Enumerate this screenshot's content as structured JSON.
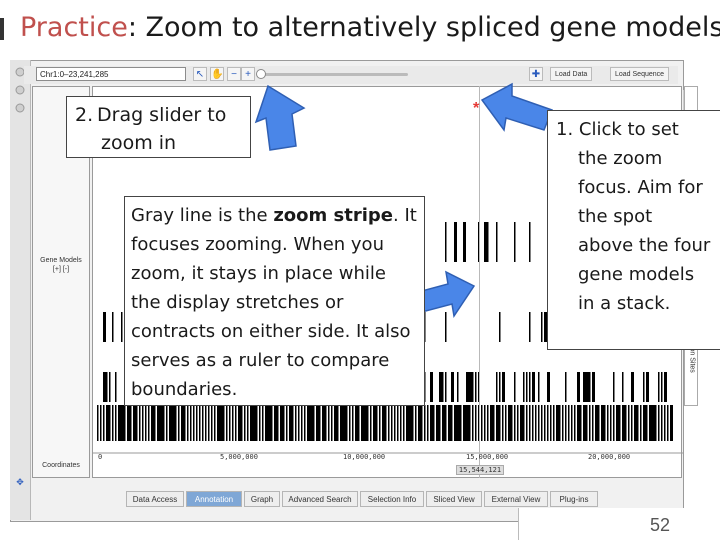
{
  "title": {
    "accent": "Practice",
    "rest": ": Zoom to alternatively spliced gene models"
  },
  "toolbar": {
    "location": "Chr1:0–23,241,285",
    "load_data": "Load Data",
    "load_sequence": "Load Sequence",
    "icons": [
      "pointer-icon",
      "pan-hand-icon",
      "zoom-out-icon",
      "zoom-in-icon",
      "gear-icon"
    ]
  },
  "tracks": {
    "gene_models_label": "Gene Models",
    "gene_models_expand": "[+] [-]",
    "coordinates_label": "Coordinates",
    "restriction_sites_label": "Restriction Sites"
  },
  "ruler": {
    "ticks": [
      "0",
      "5,000,000",
      "10,000,000",
      "15,000,000",
      "20,000,000"
    ],
    "zoom_position": "15,544,121"
  },
  "tabs": [
    "Data Access",
    "Annotation",
    "Graph",
    "Advanced Search",
    "Selection Info",
    "Sliced View",
    "External View",
    "Plug-ins"
  ],
  "active_tab": "Annotation",
  "callouts": {
    "slider": {
      "number": "2.",
      "line1": "Drag slider to",
      "line2": "zoom in"
    },
    "stripe": {
      "pre": "Gray line is the ",
      "bold": "zoom stripe",
      "post": ". It focuses zooming. When you zoom, it stays in place while the display stretches or contracts on either side. It also serves as a ruler to compare boundaries."
    },
    "focus": {
      "number": "1.",
      "line1": "Click to set",
      "rest": "the zoom focus. Aim for the spot above the four gene models in a stack."
    }
  },
  "page_number": "52",
  "colors": {
    "title_accent": "#c0504d",
    "arrow_fill": "#4a86e8",
    "zoom_star": "#e53935",
    "active_tab": "#7fa7d6"
  }
}
